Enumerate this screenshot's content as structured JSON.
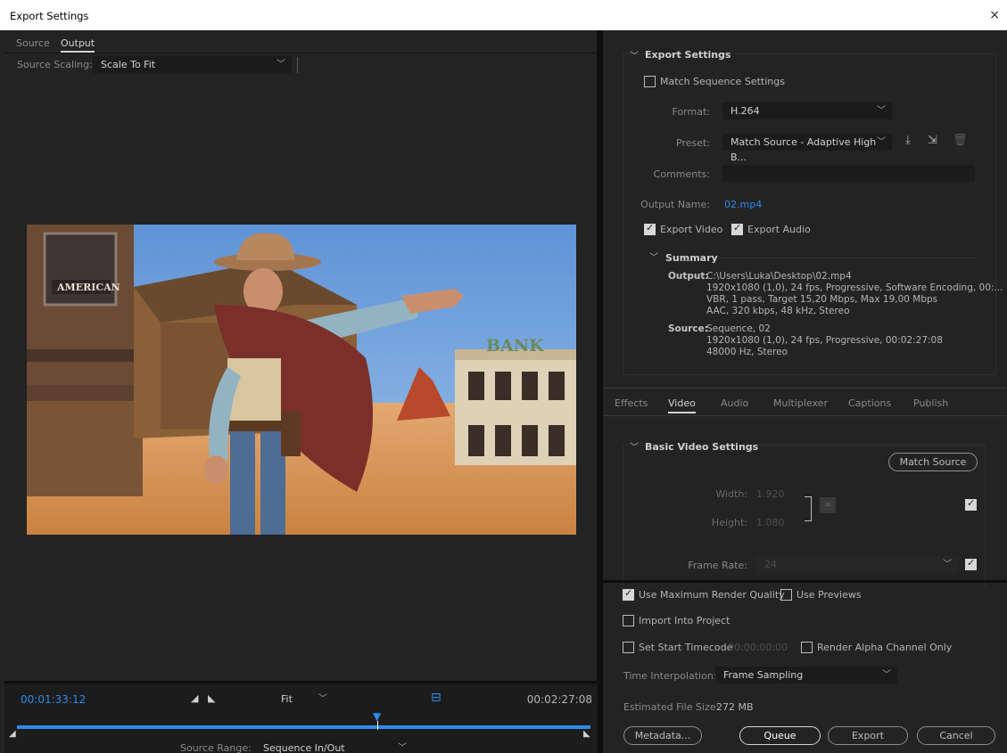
{
  "window": {
    "title": "Export Settings",
    "close": "×"
  },
  "left": {
    "tabs": [
      "Source",
      "Output"
    ],
    "source_scaling": {
      "label": "Source Scaling:",
      "value": "Scale To Fit"
    },
    "timeline": {
      "current": "00:01:33:12",
      "end": "00:02:27:08",
      "zoom": "Fit",
      "source_range_label": "Source Range:",
      "source_range_value": "Sequence In/Out"
    },
    "preview_sign_american": "AMERICAN",
    "preview_sign_bank": "BANK"
  },
  "export_settings": {
    "title": "Export Settings",
    "match_sequence": "Match Sequence Settings",
    "format_label": "Format:",
    "format_value": "H.264",
    "preset_label": "Preset:",
    "preset_value": "Match Source - Adaptive High B...",
    "comments_label": "Comments:",
    "output_name_label": "Output Name:",
    "output_name_value": "02.mp4",
    "export_video": "Export Video",
    "export_audio": "Export Audio"
  },
  "summary": {
    "title": "Summary",
    "output_key": "Output:",
    "output_lines": [
      "C:\\Users\\Luka\\Desktop\\02.mp4",
      "1920x1080 (1,0), 24 fps, Progressive, Software Encoding, 00:...",
      "VBR, 1 pass, Target 15,20 Mbps, Max 19,00 Mbps",
      "AAC, 320 kbps, 48 kHz, Stereo"
    ],
    "source_key": "Source:",
    "source_lines": [
      "Sequence, 02",
      "1920x1080 (1,0), 24 fps, Progressive, 00:02:27:08",
      "48000 Hz, Stereo"
    ]
  },
  "subtabs": [
    "Effects",
    "Video",
    "Audio",
    "Multiplexer",
    "Captions",
    "Publish"
  ],
  "video": {
    "title": "Basic Video Settings",
    "match_source": "Match Source",
    "width_label": "Width:",
    "width_value": "1.920",
    "height_label": "Height:",
    "height_value": "1.080",
    "frame_rate_label": "Frame Rate:",
    "frame_rate_value": "24"
  },
  "bottom": {
    "max_render": "Use Maximum Render Quality",
    "use_previews": "Use Previews",
    "import_project": "Import Into Project",
    "set_start_tc": "Set Start Timecode",
    "start_tc_value": "00:00:00:00",
    "render_alpha": "Render Alpha Channel Only",
    "time_interp_label": "Time Interpolation:",
    "time_interp_value": "Frame Sampling",
    "file_size_label": "Estimated File Size:",
    "file_size_value": "272 MB",
    "metadata": "Metadata...",
    "queue": "Queue",
    "export": "Export",
    "cancel": "Cancel"
  }
}
